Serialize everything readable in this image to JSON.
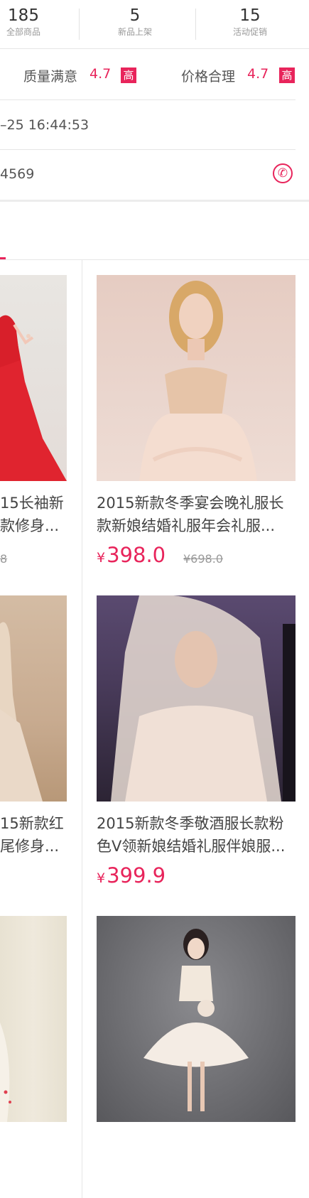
{
  "stats": [
    {
      "value": "185",
      "label": "全部商品"
    },
    {
      "value": "5",
      "label": "新品上架"
    },
    {
      "value": "15",
      "label": "活动促销"
    }
  ],
  "ratings": {
    "quality_label": "质量满意",
    "quality_value": "4.7",
    "quality_badge": "高",
    "price_label": "价格合理",
    "price_value": "4.7",
    "price_badge": "高"
  },
  "info": {
    "open_time": "–25 16:44:53",
    "phone": "4569"
  },
  "products": {
    "left": [
      {
        "title_line1": "15长袖新",
        "title_line2": "款修身...",
        "oprice": "8"
      },
      {
        "title_line1": "15新款红",
        "title_line2": "尾修身..."
      }
    ],
    "right": [
      {
        "title": "2015新款冬季宴会晚礼服长款新娘结婚礼服年会礼服...",
        "currency": "¥",
        "price": "398.0",
        "oprice": "¥698.0"
      },
      {
        "title": "2015新款冬季敬酒服长款粉色V领新娘结婚礼服伴娘服...",
        "currency": "¥",
        "price": "399.9"
      }
    ]
  },
  "colors": {
    "accent": "#e8245b",
    "divider": "#e6e6e6",
    "text": "#444444",
    "muted": "#999999"
  },
  "icons": {
    "phone": "phone-icon"
  }
}
